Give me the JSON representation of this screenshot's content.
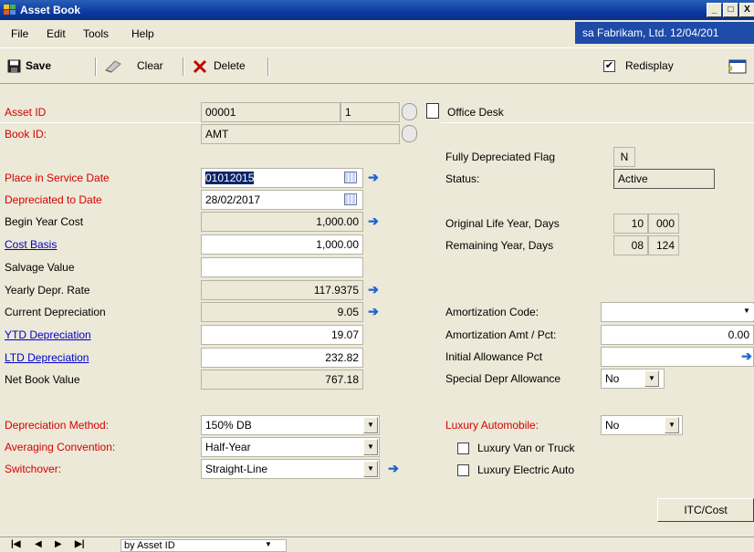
{
  "window": {
    "title": "Asset Book",
    "min_label": "_",
    "max_label": "□",
    "close_label": "X"
  },
  "menu": {
    "items": [
      "File",
      "Edit",
      "Tools",
      "Help"
    ],
    "company_info": "sa  Fabrikam, Ltd.  12/04/201"
  },
  "toolbar": {
    "save": "Save",
    "clear": "Clear",
    "delete": "Delete",
    "redisplay": "Redisplay",
    "redisplay_checked": "✔"
  },
  "asset": {
    "asset_id_label": "Asset ID",
    "asset_id": "00001",
    "suffix": "1",
    "description": "Office Desk",
    "book_id_label": "Book ID:",
    "book_id": "AMT"
  },
  "left": {
    "place_in_service_label": "Place in Service Date",
    "place_in_service": "01012015",
    "depreciated_to_label": "Depreciated to Date",
    "depreciated_to": "28/02/2017",
    "begin_year_cost_label": "Begin Year Cost",
    "begin_year_cost": "1,000.00",
    "cost_basis_label": "Cost Basis",
    "cost_basis": "1,000.00",
    "salvage_label": "Salvage Value",
    "salvage": "",
    "yearly_rate_label": "Yearly Depr. Rate",
    "yearly_rate": "117.9375",
    "current_depr_label": "Current Depreciation",
    "current_depr": "9.05",
    "ytd_label": "YTD Depreciation",
    "ytd": "19.07",
    "ltd_label": "LTD Depreciation",
    "ltd": "232.82",
    "nbv_label": "Net Book Value",
    "nbv": "767.18",
    "method_label": "Depreciation Method:",
    "method": "150% DB",
    "averaging_label": "Averaging Convention:",
    "averaging": "Half-Year",
    "switchover_label": "Switchover:",
    "switchover": "Straight-Line"
  },
  "right": {
    "fully_flag_label": "Fully Depreciated Flag",
    "fully_flag": "N",
    "status_label": "Status:",
    "status": "Active",
    "orig_life_label": "Original Life Year, Days",
    "orig_life_year": "10",
    "orig_life_days": "000",
    "remaining_label": "Remaining Year, Days",
    "remaining_year": "08",
    "remaining_days": "124",
    "amort_code_label": "Amortization Code:",
    "amort_code": "",
    "amort_amt_label": "Amortization Amt / Pct:",
    "amort_amt": "0.00",
    "initial_allow_label": "Initial Allowance Pct",
    "initial_allow": "",
    "special_allow_label": "Special Depr Allowance",
    "special_allow": "No",
    "luxury_label": "Luxury Automobile:",
    "luxury": "No",
    "lux_van_label": "Luxury Van or Truck",
    "lux_electric_label": "Luxury Electric Auto"
  },
  "buttons": {
    "itc_cost": "ITC/Cost"
  },
  "footer": {
    "sort_by": "by Asset ID"
  },
  "colors": {
    "required_label": "#d40000",
    "link": "#0000cc",
    "titlebar": "#0a3aa0",
    "arrow": "#1e63d0"
  }
}
